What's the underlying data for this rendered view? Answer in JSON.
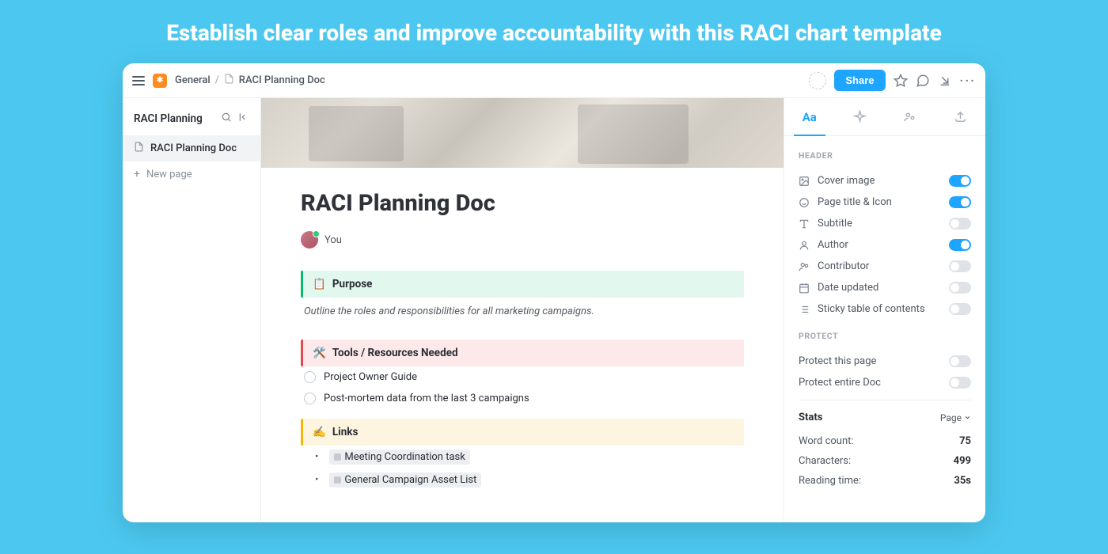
{
  "tagline": "Establish clear roles and improve accountability with this RACI chart template",
  "breadcrumb": {
    "workspace": "General",
    "doc": "RACI Planning Doc"
  },
  "topbar": {
    "share": "Share"
  },
  "sidebar": {
    "title": "RACI Planning",
    "active_item": "RACI Planning Doc",
    "new_page": "New page"
  },
  "doc": {
    "title": "RACI Planning Doc",
    "author": "You",
    "purpose": {
      "heading": "Purpose",
      "icon": "📋",
      "text": "Outline the roles and responsibilities for all marketing campaigns."
    },
    "tools": {
      "heading": "Tools / Resources Needed",
      "icon": "🛠️",
      "items": [
        "Project Owner Guide",
        "Post-mortem data from the last 3 campaigns"
      ]
    },
    "links": {
      "heading": "Links",
      "icon": "✍️",
      "items": [
        "Meeting Coordination task",
        "General Campaign Asset List"
      ]
    }
  },
  "panel": {
    "tab_active": "Aa",
    "sections": {
      "header": {
        "title": "HEADER",
        "rows": [
          {
            "label": "Cover image",
            "on": true
          },
          {
            "label": "Page title & Icon",
            "on": true
          },
          {
            "label": "Subtitle",
            "on": false
          },
          {
            "label": "Author",
            "on": true
          },
          {
            "label": "Contributor",
            "on": false
          },
          {
            "label": "Date updated",
            "on": false
          },
          {
            "label": "Sticky table of contents",
            "on": false
          }
        ]
      },
      "protect": {
        "title": "PROTECT",
        "rows": [
          {
            "label": "Protect this page",
            "on": false
          },
          {
            "label": "Protect entire Doc",
            "on": false
          }
        ]
      },
      "stats": {
        "title": "Stats",
        "scope": "Page",
        "rows": [
          {
            "k": "Word count:",
            "v": "75"
          },
          {
            "k": "Characters:",
            "v": "499"
          },
          {
            "k": "Reading time:",
            "v": "35s"
          }
        ]
      }
    }
  }
}
